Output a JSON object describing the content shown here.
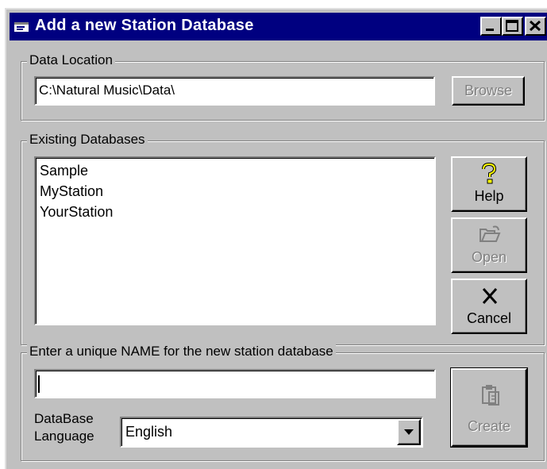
{
  "window": {
    "title": "Add a new Station Database"
  },
  "data_location": {
    "group_label": "Data Location",
    "path_value": "C:\\Natural Music\\Data\\",
    "browse_label": "Browse"
  },
  "existing": {
    "group_label": "Existing Databases",
    "items": [
      "Sample",
      "MyStation",
      "YourStation"
    ],
    "help_label": "Help",
    "open_label": "Open",
    "cancel_label": "Cancel"
  },
  "new_db": {
    "group_label": "Enter a unique NAME for the new station database",
    "name_value": "",
    "language_label_line1": "DataBase",
    "language_label_line2": "Language",
    "language_value": "English",
    "create_label": "Create"
  },
  "icons": {
    "title": "window-app-icon",
    "help": "question-key-icon",
    "open": "open-folder-icon",
    "cancel": "x-cancel-icon",
    "create": "clipboard-create-icon"
  },
  "colors": {
    "titlebar": "#000080",
    "face": "#c0c0c0",
    "disabled_text": "#808080"
  }
}
